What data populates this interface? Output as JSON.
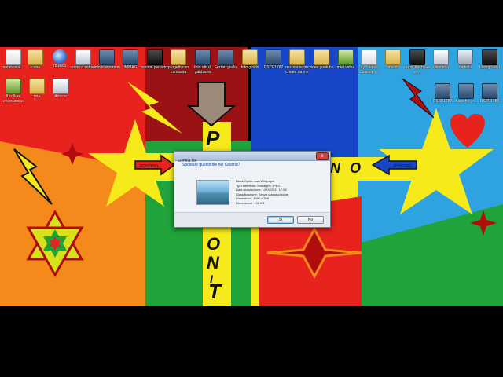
{
  "desktop": {
    "icons": [
      {
        "label": "nonevocal...",
        "kind": "file"
      },
      {
        "label": "Icone",
        "kind": "folder"
      },
      {
        "label": "musica",
        "kind": "globe"
      },
      {
        "label": "uomo a zattera",
        "kind": "app"
      },
      {
        "label": "foto trasparenti",
        "kind": "photo"
      },
      {
        "label": "IMMAG",
        "kind": "photo"
      },
      {
        "label": "tutorial per retro",
        "kind": "media"
      },
      {
        "label": "progetti con camtasia",
        "kind": "folder"
      },
      {
        "label": "foto atti di gabbiano",
        "kind": "photo"
      },
      {
        "label": "Ferrari giallo",
        "kind": "photo"
      },
      {
        "label": "foto giochi",
        "kind": "folder"
      },
      {
        "label": "DSCF1782",
        "kind": "photo"
      },
      {
        "label": "musica remix create da me",
        "kind": "folder"
      },
      {
        "label": "video youtube",
        "kind": "folder"
      },
      {
        "label": "miei video",
        "kind": "green"
      },
      {
        "label": "Jay Santos - Caliente (...",
        "kind": "file"
      },
      {
        "label": "music",
        "kind": "folder"
      },
      {
        "label": "remix the black ey...",
        "kind": "media"
      },
      {
        "label": "valentino",
        "kind": "app"
      },
      {
        "label": "cartella",
        "kind": "bin"
      },
      {
        "label": "background",
        "kind": "media"
      }
    ],
    "row2_icons": [
      {
        "label": "Il collare colorazione",
        "kind": "green"
      },
      {
        "label": "mia",
        "kind": "folder"
      },
      {
        "label": "Articoa",
        "kind": "app"
      }
    ],
    "right_icons": [
      {
        "label": "DSCF1787",
        "kind": "photo"
      },
      {
        "label": "Bianche_c...",
        "kind": "photo"
      },
      {
        "label": "DSCF1783",
        "kind": "photo"
      }
    ]
  },
  "wallpaper": {
    "letters": [
      "P",
      "O",
      "N",
      "T",
      "I",
      "N",
      "O"
    ],
    "arrow_labels": [
      "PONTINO",
      "PONTINO"
    ]
  },
  "dialog": {
    "title": "Elimina file",
    "question": "Spostare questo file nel Cestino?",
    "file_name": "Black-Spiderman-Wallpaper",
    "details": [
      "Tipo elemento: Immagine JPEG",
      "Data acquisizione: 12/04/2011 17:58",
      "Classificazione: Senza classificazione",
      "Dimensioni: 1280 x 768",
      "Dimensione: 101 KB"
    ],
    "yes_label": "Sì",
    "no_label": "No",
    "close_label": "x"
  },
  "colors": {
    "orange": "#f58a1c",
    "red": "#e8221c",
    "darkred": "#9a1214",
    "yellow": "#f7ea1a",
    "green": "#1fa33a",
    "blue": "#1747c8",
    "lightblue": "#2ea3df"
  }
}
